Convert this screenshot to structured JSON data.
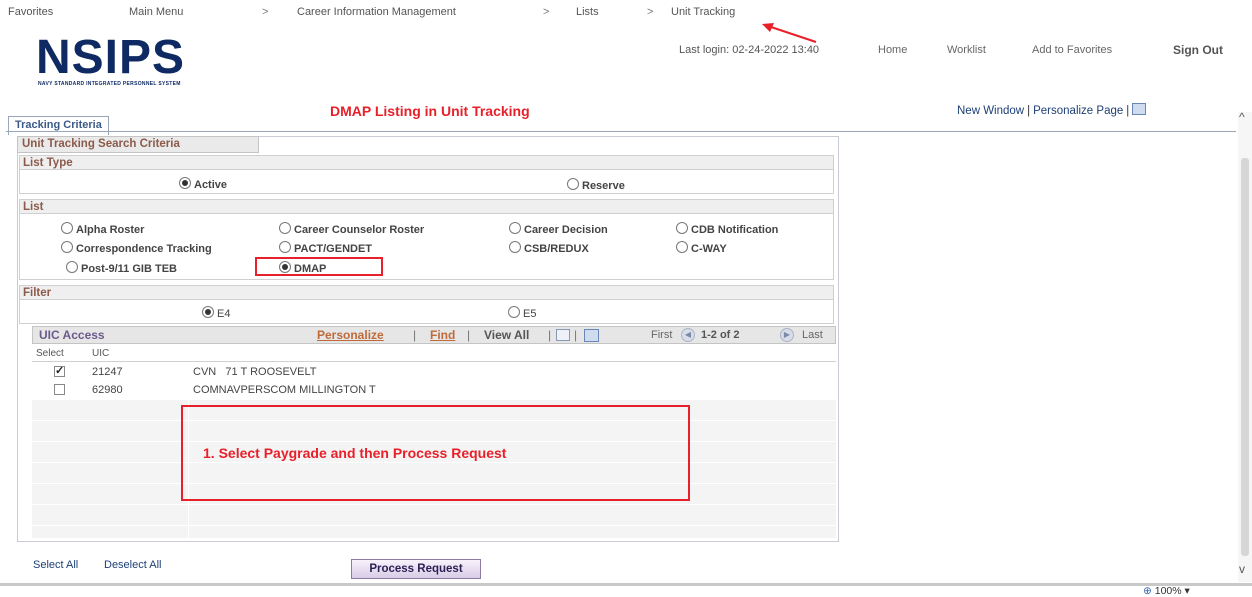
{
  "breadcrumb": {
    "items": [
      "Favorites",
      "Main Menu",
      "Career Information Management",
      "Lists",
      "Unit Tracking"
    ],
    "separator": ">"
  },
  "logo": {
    "word": "NSIPS",
    "subtitle": "NAVY STANDARD INTEGRATED PERSONNEL SYSTEM"
  },
  "header": {
    "last_login": "Last login: 02-24-2022 13:40",
    "links": [
      "Home",
      "Worklist",
      "Add to Favorites",
      "Sign Out"
    ]
  },
  "annotation_title": "DMAP Listing in Unit Tracking",
  "page_links": {
    "new_window": "New Window",
    "personalize": "Personalize Page"
  },
  "tab": {
    "label": "Tracking Criteria"
  },
  "search": {
    "title": "Unit Tracking Search Criteria",
    "list_type": {
      "title": "List Type",
      "options": [
        {
          "label": "Active",
          "selected": true
        },
        {
          "label": "Reserve",
          "selected": false
        }
      ]
    },
    "list": {
      "title": "List",
      "options": [
        {
          "label": "Alpha Roster",
          "selected": false
        },
        {
          "label": "Career Counselor Roster",
          "selected": false
        },
        {
          "label": "Career Decision",
          "selected": false
        },
        {
          "label": "CDB Notification",
          "selected": false
        },
        {
          "label": "Correspondence Tracking",
          "selected": false
        },
        {
          "label": "PACT/GENDET",
          "selected": false
        },
        {
          "label": "CSB/REDUX",
          "selected": false
        },
        {
          "label": "C-WAY",
          "selected": false
        },
        {
          "label": "Post-9/11 GIB TEB",
          "selected": false
        },
        {
          "label": "DMAP",
          "selected": true
        }
      ]
    },
    "filter": {
      "title": "Filter",
      "options": [
        {
          "label": "E4",
          "selected": true
        },
        {
          "label": "E5",
          "selected": false
        }
      ]
    }
  },
  "grid": {
    "title": "UIC Access",
    "personalize": "Personalize",
    "find": "Find",
    "view_all": "View All",
    "nav": {
      "first": "First",
      "range": "1-2 of 2",
      "last": "Last"
    },
    "columns": [
      "Select",
      "UIC"
    ],
    "rows": [
      {
        "checked": true,
        "uic": "21247",
        "name": "CVN   71 T ROOSEVELT"
      },
      {
        "checked": false,
        "uic": "62980",
        "name": "COMNAVPERSCOM MILLINGTON T"
      }
    ]
  },
  "instruction": "1.  Select Paygrade and then Process Request",
  "actions": {
    "select_all": "Select All",
    "deselect_all": "Deselect All",
    "process": "Process Request"
  },
  "status": {
    "zoom": "100%"
  },
  "colors": {
    "annotation_red": "#e8202a",
    "brand_navy": "#0f2a63",
    "section_title": "#8b5a4a"
  }
}
